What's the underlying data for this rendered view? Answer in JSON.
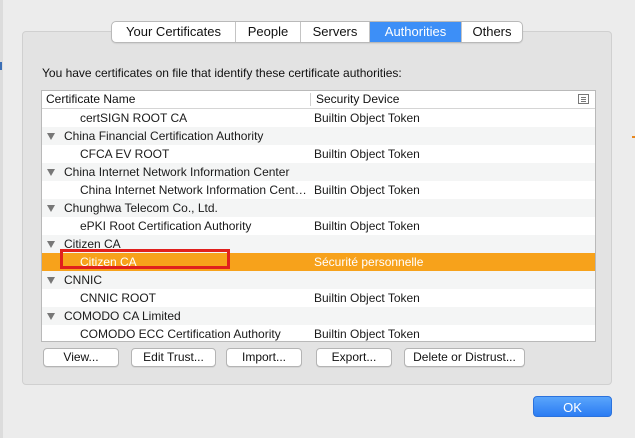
{
  "tabs": [
    "Your Certificates",
    "People",
    "Servers",
    "Authorities",
    "Others"
  ],
  "active_tab": "Authorities",
  "description": "You have certificates on file that identify these certificate authorities:",
  "table": {
    "columns": [
      "Certificate Name",
      "Security Device"
    ],
    "rows": [
      {
        "type": "cert",
        "name": "certSIGN ROOT CA",
        "device": "Builtin Object Token"
      },
      {
        "type": "group",
        "name": "China Financial Certification Authority"
      },
      {
        "type": "cert",
        "name": "CFCA EV ROOT",
        "device": "Builtin Object Token"
      },
      {
        "type": "group",
        "name": "China Internet Network Information Center"
      },
      {
        "type": "cert",
        "name": "China Internet Network Information Center...",
        "device": "Builtin Object Token"
      },
      {
        "type": "group",
        "name": "Chunghwa Telecom Co., Ltd."
      },
      {
        "type": "cert",
        "name": "ePKI Root Certification Authority",
        "device": "Builtin Object Token"
      },
      {
        "type": "group",
        "name": "Citizen CA"
      },
      {
        "type": "cert",
        "name": "Citizen CA",
        "device": "Sécurité personnelle",
        "selected": true
      },
      {
        "type": "group",
        "name": "CNNIC"
      },
      {
        "type": "cert",
        "name": "CNNIC ROOT",
        "device": "Builtin Object Token"
      },
      {
        "type": "group",
        "name": "COMODO CA Limited"
      },
      {
        "type": "cert",
        "name": "COMODO ECC Certification Authority",
        "device": "Builtin Object Token"
      }
    ]
  },
  "buttons": {
    "view": "View...",
    "edit_trust": "Edit Trust...",
    "import": "Import...",
    "export": "Export...",
    "delete": "Delete or Distrust...",
    "ok": "OK"
  },
  "colors": {
    "selection": "#f7a21b",
    "highlight_box": "#e0201d",
    "accent": "#3d8ff7"
  }
}
